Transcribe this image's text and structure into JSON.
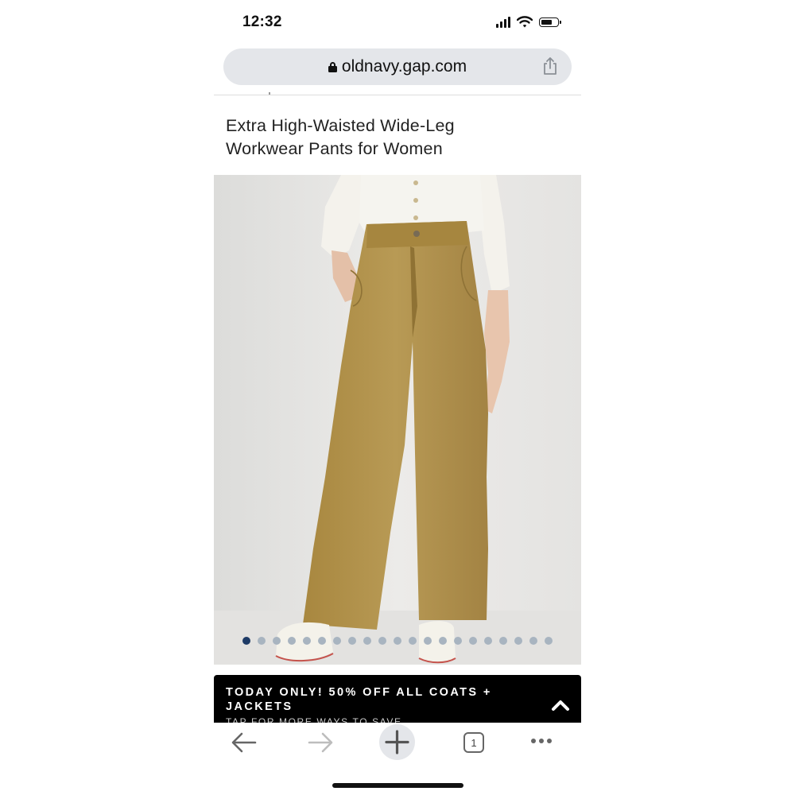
{
  "status_bar": {
    "time": "12:32"
  },
  "browser": {
    "url": "oldnavy.gap.com",
    "icons": [
      "lock-icon",
      "share-icon"
    ]
  },
  "product": {
    "title_line1": "Extra High-Waisted Wide-Leg",
    "title_line2": "Workwear Pants for Women",
    "image_alt": "model wearing tan wide-leg workwear pants, white ribbed top and white sneakers",
    "gallery": {
      "total": 21,
      "current": 1
    }
  },
  "promo": {
    "title": "TODAY ONLY! 50% OFF ALL COATS + JACKETS",
    "subtitle": "TAP FOR MORE WAYS TO SAVE"
  },
  "toolbar": {
    "tab_count": "1",
    "icons": [
      "back-arrow-icon",
      "forward-arrow-icon",
      "plus-icon",
      "tabs-icon",
      "more-icon"
    ]
  },
  "colors": {
    "pants": "#b0924d",
    "gallery_active": "#1e3b66",
    "gallery_inactive": "#a8b4c0",
    "banner": "#000000"
  }
}
